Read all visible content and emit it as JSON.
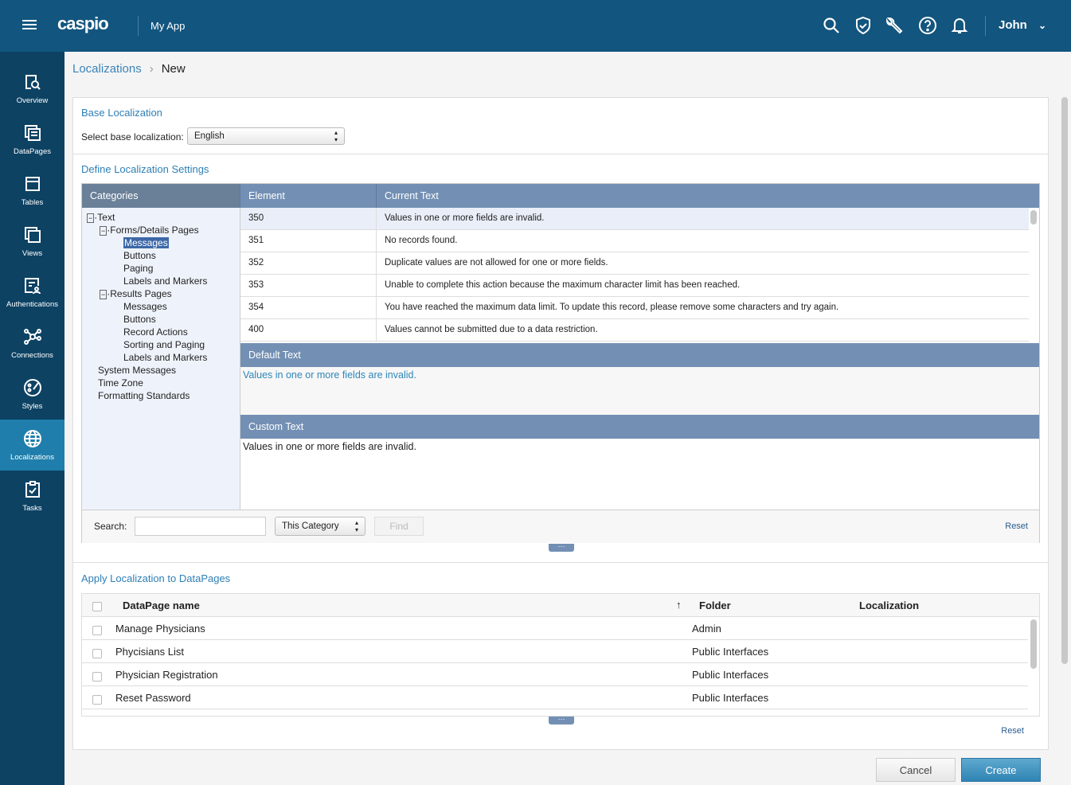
{
  "topbar": {
    "logo": "caspio",
    "app_name": "My App",
    "user": "John",
    "icons": [
      "search-icon",
      "shield-check-icon",
      "wrench-icon",
      "help-icon",
      "bell-icon"
    ]
  },
  "sidebar": {
    "items": [
      {
        "label": "Overview"
      },
      {
        "label": "DataPages"
      },
      {
        "label": "Tables"
      },
      {
        "label": "Views"
      },
      {
        "label": "Authentications"
      },
      {
        "label": "Connections"
      },
      {
        "label": "Styles"
      },
      {
        "label": "Localizations",
        "active": true
      },
      {
        "label": "Tasks"
      }
    ]
  },
  "breadcrumb": {
    "parent": "Localizations",
    "current": "New"
  },
  "base": {
    "title": "Base Localization",
    "label": "Select base localization:",
    "value": "English"
  },
  "define": {
    "title": "Define Localization Settings",
    "col_categories": "Categories",
    "col_element": "Element",
    "col_current": "Current Text",
    "tree": [
      "Text",
      "Forms/Details Pages",
      "Messages",
      "Buttons",
      "Paging",
      "Labels and Markers",
      "Results Pages",
      "Messages",
      "Buttons",
      "Record Actions",
      "Sorting and Paging",
      "Labels and Markers",
      "System Messages",
      "Time Zone",
      "Formatting Standards"
    ],
    "rows": [
      {
        "element": "350",
        "text": "Values in one or more fields are invalid."
      },
      {
        "element": "351",
        "text": "No records found."
      },
      {
        "element": "352",
        "text": "Duplicate values are not allowed for one or more fields."
      },
      {
        "element": "353",
        "text": "Unable to complete this action because the maximum character limit has been reached."
      },
      {
        "element": "354",
        "text": "You have reached the maximum data limit. To update this record, please remove some characters and try again."
      },
      {
        "element": "400",
        "text": "Values cannot be submitted due to a data restriction."
      }
    ],
    "default_title": "Default Text",
    "default_text": "Values in one or more fields are invalid.",
    "custom_title": "Custom Text",
    "custom_text": "Values in one or more fields are invalid.",
    "search_label": "Search:",
    "search_value": "",
    "scope": "This Category",
    "find": "Find",
    "reset": "Reset"
  },
  "apply": {
    "title": "Apply Localization to DataPages",
    "col_name": "DataPage name",
    "col_folder": "Folder",
    "col_localization": "Localization",
    "rows": [
      {
        "name": "Manage Physicians",
        "folder": "Admin"
      },
      {
        "name": "Phycisians List",
        "folder": "Public Interfaces"
      },
      {
        "name": "Physician Registration",
        "folder": "Public Interfaces"
      },
      {
        "name": "Reset Password",
        "folder": "Public Interfaces"
      }
    ],
    "reset": "Reset"
  },
  "actions": {
    "cancel": "Cancel",
    "create": "Create"
  }
}
